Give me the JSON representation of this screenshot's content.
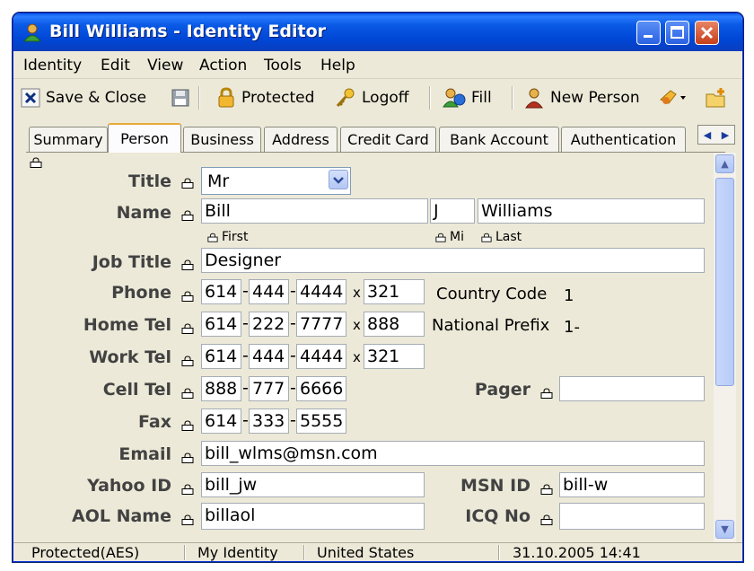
{
  "window": {
    "title": "Bill Williams - Identity Editor"
  },
  "menu": [
    "Identity",
    "Edit",
    "View",
    "Action",
    "Tools",
    "Help"
  ],
  "toolbar": {
    "save_close": "Save & Close",
    "protected": "Protected",
    "logoff": "Logoff",
    "fill": "Fill",
    "new_person": "New Person"
  },
  "tabs": [
    "Summary",
    "Person",
    "Business",
    "Address",
    "Credit Card",
    "Bank Account",
    "Authentication"
  ],
  "active_tab": "Person",
  "form": {
    "title_label": "Title",
    "title_value": "Mr",
    "name_label": "Name",
    "first": "Bill",
    "mi": "J",
    "last": "Williams",
    "first_caption": "First",
    "mi_caption": "Mi",
    "last_caption": "Last",
    "job_title_label": "Job Title",
    "job_title": "Designer",
    "phone_label": "Phone",
    "phone": [
      "614",
      "444",
      "4444"
    ],
    "phone_ext": "321",
    "country_code_label": "Country Code",
    "country_code": "1",
    "home_tel_label": "Home Tel",
    "home_tel": [
      "614",
      "222",
      "7777"
    ],
    "home_ext": "888",
    "national_prefix_label": "National Prefix",
    "national_prefix": "1-",
    "work_tel_label": "Work Tel",
    "work_tel": [
      "614",
      "444",
      "4444"
    ],
    "work_ext": "321",
    "cell_tel_label": "Cell Tel",
    "cell_tel": [
      "888",
      "777",
      "6666"
    ],
    "pager_label": "Pager",
    "pager": "",
    "fax_label": "Fax",
    "fax": [
      "614",
      "333",
      "5555"
    ],
    "email_label": "Email",
    "email": "bill_wlms@msn.com",
    "yahoo_label": "Yahoo ID",
    "yahoo": "bill_jw",
    "msn_label": "MSN ID",
    "msn": "bill-w",
    "aol_label": "AOL Name",
    "aol": "billaol",
    "icq_label": "ICQ No",
    "icq": "",
    "ext_sep": "x",
    "dash": "-"
  },
  "status": {
    "encryption": "Protected(AES)",
    "identity": "My Identity",
    "country": "United States",
    "datetime": "31.10.2005 14:41"
  },
  "colors": {
    "titlebar": "#0a5ae6",
    "label": "#424242",
    "active_tab_accent": "#e8a93a"
  }
}
